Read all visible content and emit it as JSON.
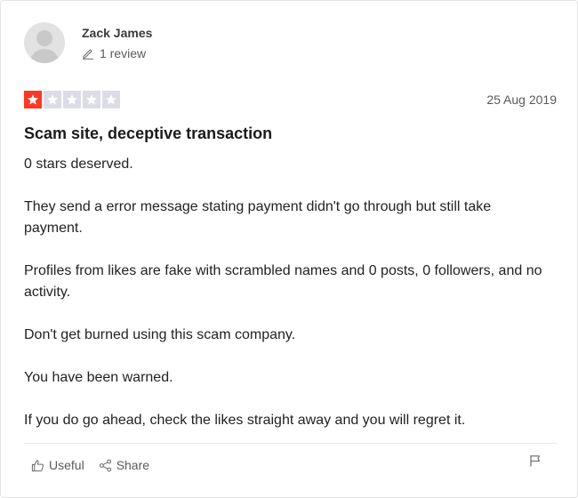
{
  "reviewer": {
    "name": "Zack James",
    "review_count": "1 review"
  },
  "review": {
    "rating": 1,
    "rating_max": 5,
    "date": "25 Aug 2019",
    "title": "Scam site, deceptive transaction",
    "paragraphs": [
      "0 stars deserved.",
      "They send a error message stating payment didn't go through but still take payment.",
      "Profiles from likes are fake with scrambled names and 0 posts, 0 followers, and no activity.",
      "Don't get burned using this scam company.",
      "You have been warned.",
      "If you do go ahead, check the likes straight away and you will regret it."
    ]
  },
  "actions": {
    "useful_label": "Useful",
    "share_label": "Share"
  },
  "icons": {
    "avatar": "user-avatar-placeholder",
    "review_count": "pencil-icon",
    "useful": "thumbs-up-icon",
    "share": "share-icon",
    "flag": "flag-icon"
  },
  "colors": {
    "star_filled": "#ff3722",
    "star_empty": "#dcdce6"
  }
}
